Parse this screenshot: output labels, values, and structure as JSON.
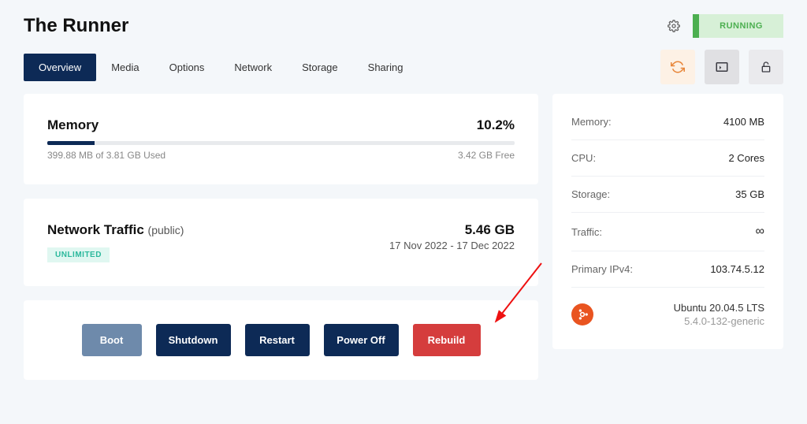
{
  "header": {
    "title": "The Runner",
    "status": "RUNNING"
  },
  "tabs": [
    "Overview",
    "Media",
    "Options",
    "Network",
    "Storage",
    "Sharing"
  ],
  "memory": {
    "label": "Memory",
    "percent": "10.2%",
    "used": "399.88 MB of 3.81 GB Used",
    "free": "3.42 GB Free"
  },
  "traffic": {
    "title": "Network Traffic",
    "subtitle": "(public)",
    "badge": "UNLIMITED",
    "value": "5.46 GB",
    "dates": "17 Nov 2022 - 17 Dec 2022"
  },
  "actions": {
    "boot": "Boot",
    "shutdown": "Shutdown",
    "restart": "Restart",
    "poweroff": "Power Off",
    "rebuild": "Rebuild"
  },
  "specs": {
    "memory_label": "Memory:",
    "memory_value": "4100 MB",
    "cpu_label": "CPU:",
    "cpu_value": "2 Cores",
    "storage_label": "Storage:",
    "storage_value": "35 GB",
    "traffic_label": "Traffic:",
    "traffic_value": "∞",
    "ipv4_label": "Primary IPv4:",
    "ipv4_value": "103.74.5.12",
    "os_name": "Ubuntu 20.04.5 LTS",
    "os_kernel": "5.4.0-132-generic"
  }
}
